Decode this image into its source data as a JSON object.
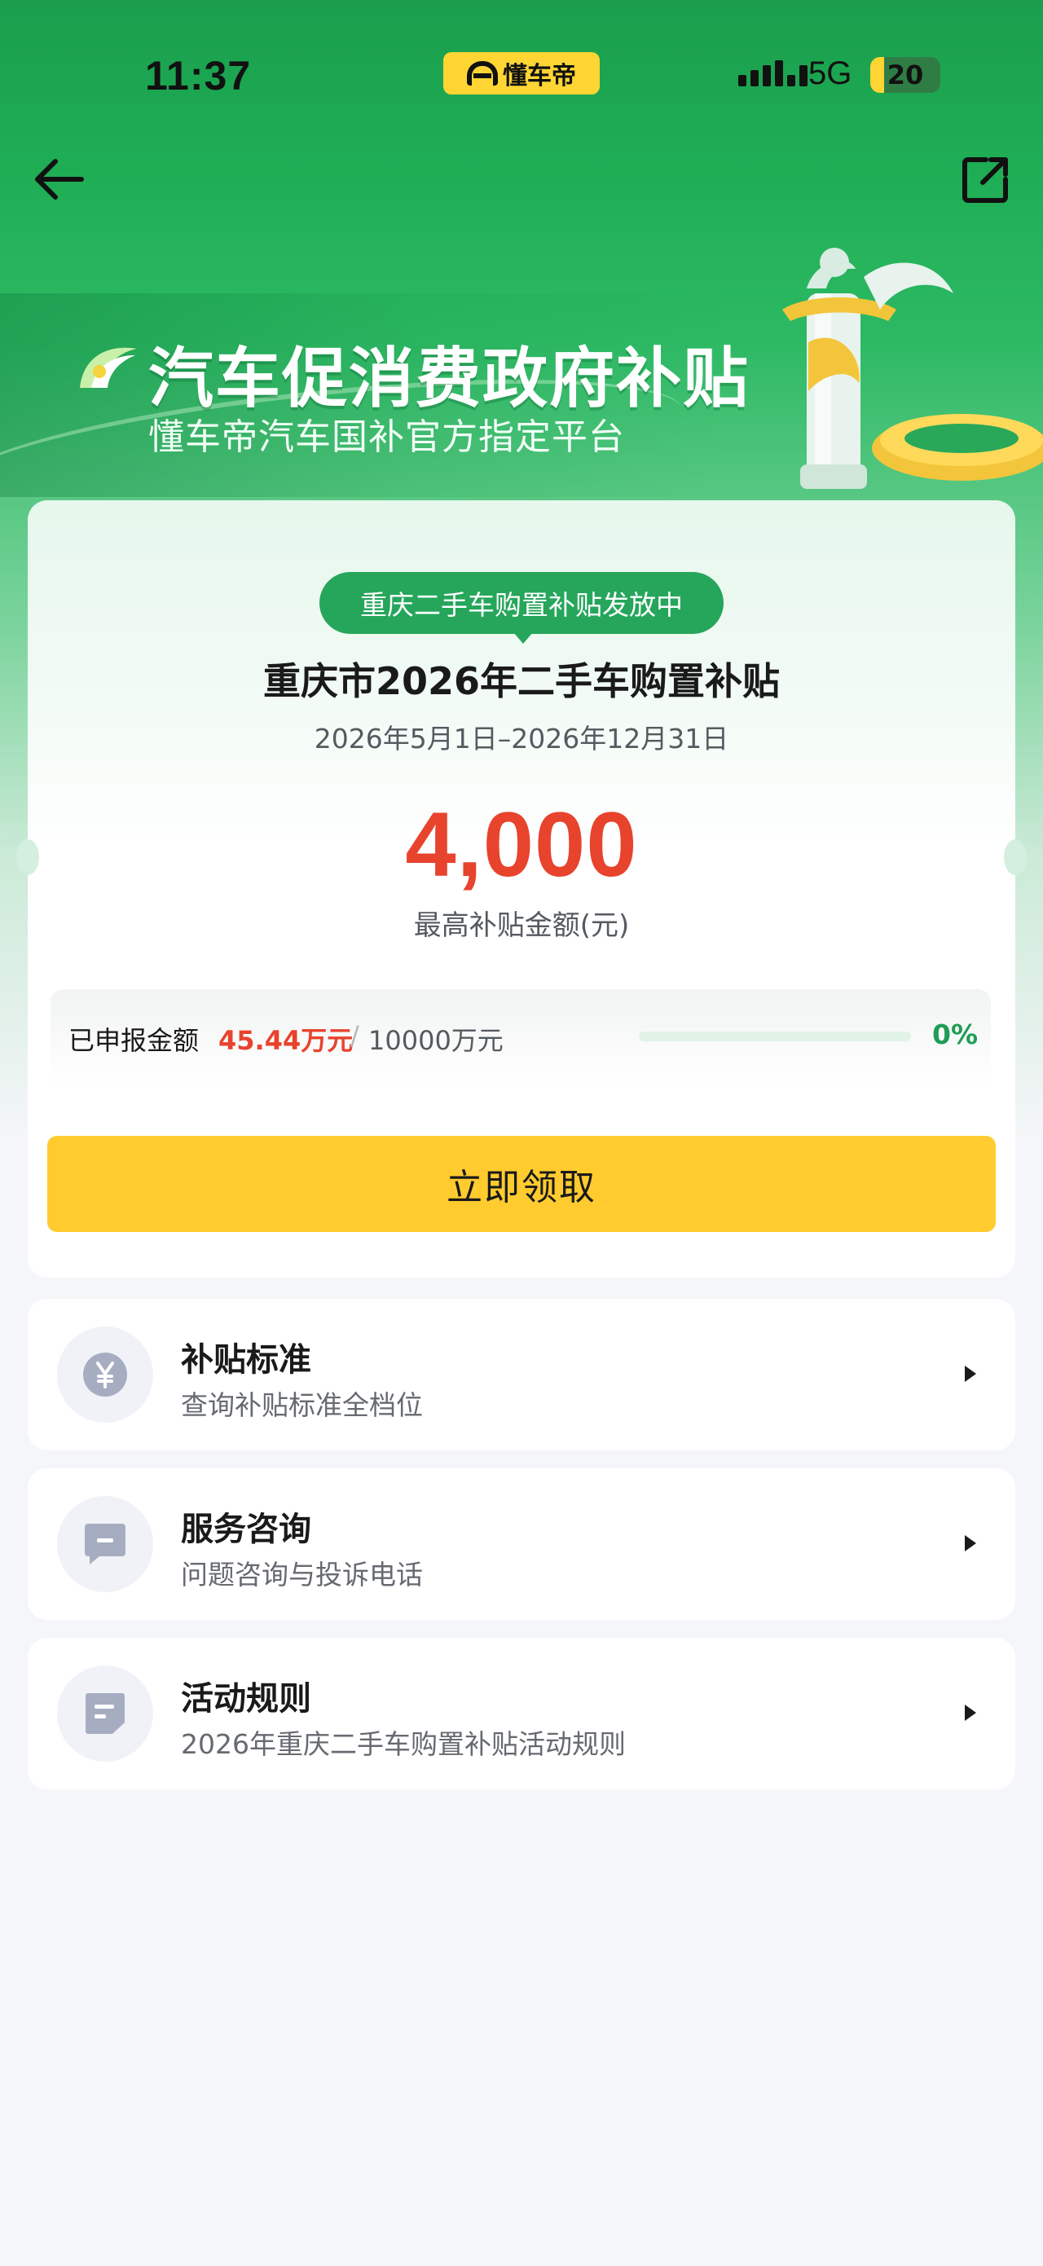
{
  "status_bar": {
    "time": "11:37",
    "app_badge": "懂车帝",
    "network": "5G",
    "battery": "20"
  },
  "banner": {
    "title": "汽车促消费政府补贴",
    "subtitle": "懂车帝汽车国补官方指定平台"
  },
  "subsidy": {
    "status": "重庆二手车购置补贴发放中",
    "title": "重庆市2026年二手车购置补贴",
    "dates": "2026年5月1日–2026年12月31日",
    "amount": "4,000",
    "amount_label": "最高补贴金额(元)",
    "progress": {
      "label": "已申报金额",
      "value": "45.44万元",
      "separator": "/",
      "total": "10000万元",
      "percent_text": "0%",
      "fill_percent": 0
    },
    "claim_button": "立即领取"
  },
  "items": [
    {
      "title": "补贴标准",
      "desc": "查询补贴标准全档位",
      "icon": "yen-coin-icon"
    },
    {
      "title": "服务咨询",
      "desc": "问题咨询与投诉电话",
      "icon": "chat-bubble-icon"
    },
    {
      "title": "活动规则",
      "desc": "2026年重庆二手车购置补贴活动规则",
      "icon": "document-icon"
    }
  ],
  "colors": {
    "brand_green": "#1fae55",
    "accent_red": "#e8432d",
    "button_yellow": "#ffcb2f",
    "icon_gray": "#a7adc1"
  }
}
